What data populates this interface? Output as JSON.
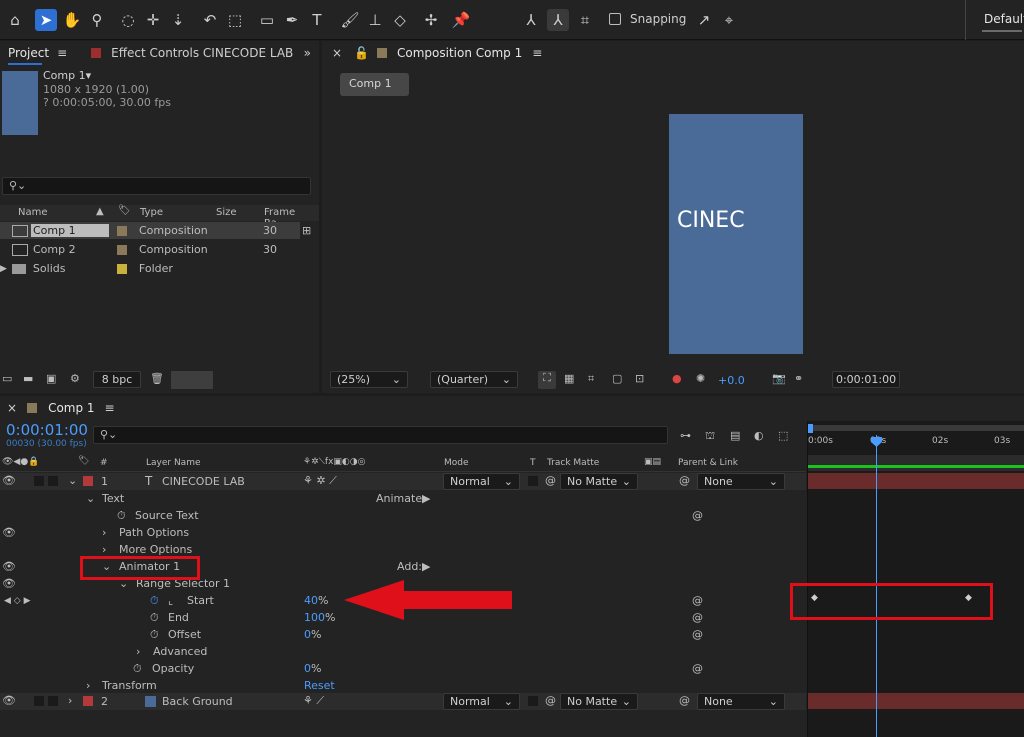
{
  "toolbar": {
    "snapping": "Snapping",
    "workspace": "Default"
  },
  "project": {
    "tab": "Project",
    "effect_tab": "Effect Controls CINECODE LAB",
    "item_name": "Comp 1▾",
    "item_size": "1080 x 1920 (1.00)",
    "item_dur": "? 0:00:05:00, 30.00 fps",
    "search_placeholder": "",
    "headers": {
      "name": "Name",
      "type": "Type",
      "size": "Size",
      "frame": "Frame Ra..."
    },
    "items": [
      {
        "name": "Comp 1",
        "type": "Composition",
        "fps": "30"
      },
      {
        "name": "Comp 2",
        "type": "Composition",
        "fps": "30"
      },
      {
        "name": "Solids",
        "type": "Folder",
        "fps": ""
      }
    ],
    "bpc": "8 bpc"
  },
  "comp": {
    "tab": "Composition Comp 1",
    "chip": "Comp 1",
    "text": "CINEC",
    "zoom": "(25%)",
    "quality": "(Quarter)",
    "exposure": "+0.0",
    "time": "0:00:01:00"
  },
  "timeline": {
    "tab": "Comp 1",
    "time": "0:00:01:00",
    "frames": "00030 (30.00 fps)",
    "cols": {
      "num": "#",
      "layer": "Layer Name",
      "mode": "Mode",
      "t": "T",
      "matte": "Track Matte",
      "parent": "Parent & Link"
    },
    "ruler": [
      "0:00s",
      "01s",
      "02s",
      "03s"
    ],
    "layer1": {
      "num": "1",
      "t": "T",
      "name": "CINECODE LAB",
      "mode": "Normal",
      "matte": "No Matte",
      "parent": "None"
    },
    "text_group": "Text",
    "animate": "Animate:",
    "source_text": "Source Text",
    "path_options": "Path Options",
    "more_options": "More Options",
    "animator": "Animator 1",
    "add": "Add:",
    "range": "Range Selector 1",
    "start": {
      "label": "Start",
      "num": "40",
      "pct": "%"
    },
    "end": {
      "label": "End",
      "num": "100",
      "pct": "%"
    },
    "offset": {
      "label": "Offset",
      "num": "0",
      "pct": "%"
    },
    "advanced": "Advanced",
    "opacity": {
      "label": "Opacity",
      "num": "0",
      "pct": "%"
    },
    "transform": "Transform",
    "reset": "Reset",
    "layer2": {
      "num": "2",
      "name": "Back Ground",
      "mode": "Normal",
      "matte": "No Matte",
      "parent": "None"
    }
  },
  "colors": {
    "accent": "#2d6fd3",
    "comp_bg": "#4a6b97",
    "red": "#e0101a",
    "label_red": "#b23a3a"
  }
}
